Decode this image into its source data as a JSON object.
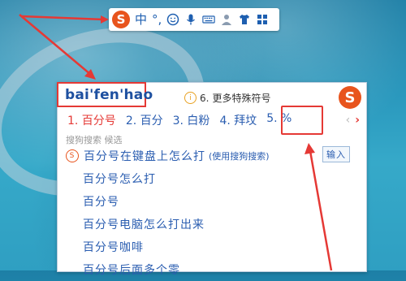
{
  "toolbar": {
    "logo": "S",
    "lang": "中",
    "punct": "°,",
    "icons": [
      "smiley-icon",
      "microphone-icon",
      "keyboard-icon",
      "user-icon",
      "shirt-icon",
      "grid-icon"
    ]
  },
  "input": {
    "value": "bai'fen'hao"
  },
  "panel": {
    "hint_number": "6.",
    "hint_text": "更多特殊符号",
    "logo": "S",
    "candidates": [
      "1. 百分号",
      "2. 百分",
      "3. 白粉",
      "4. 拜坟",
      "5. %"
    ],
    "nav_prev": "‹",
    "nav_next": "›",
    "search_label": "搜狗搜索  候选",
    "suggestions": [
      {
        "text": "百分号在键盘上怎么打",
        "note": "(使用搜狗搜索)",
        "button": "输入",
        "icon": "sogou-search-icon"
      },
      {
        "text": "百分号怎么打"
      },
      {
        "text": "百分号"
      },
      {
        "text": "百分号电脑怎么打出来"
      },
      {
        "text": "百分号咖啡"
      },
      {
        "text": "百分号后面多个零"
      }
    ]
  },
  "colors": {
    "accent_red": "#e53935",
    "brand_orange": "#e8541d",
    "text_blue": "#2a5db0"
  }
}
